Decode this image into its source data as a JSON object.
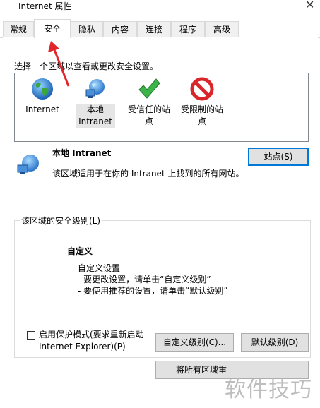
{
  "window": {
    "title": "Internet 属性"
  },
  "tabs": [
    {
      "label": "常规"
    },
    {
      "label": "安全"
    },
    {
      "label": "隐私"
    },
    {
      "label": "内容"
    },
    {
      "label": "连接"
    },
    {
      "label": "程序"
    },
    {
      "label": "高级"
    }
  ],
  "zones": {
    "instruction": "选择一个区域以查看或更改安全设置。",
    "items": [
      {
        "line1": "Internet",
        "line2": "",
        "icon": "globe-icon"
      },
      {
        "line1": "本地",
        "line2": "Intranet",
        "icon": "network-globe-icon"
      },
      {
        "line1": "受信任的站",
        "line2": "点",
        "icon": "green-check-icon"
      },
      {
        "line1": "受限制的站",
        "line2": "点",
        "icon": "no-entry-icon"
      }
    ]
  },
  "selected_zone": {
    "title": "本地 Intranet",
    "description": "该区域适用于在你的 Intranet 上找到的所有网站。",
    "sites_button": "站点(S)"
  },
  "security_level": {
    "legend": "该区域的安全级别(L)",
    "level_name": "自定义",
    "lines": [
      "自定义设置",
      "- 要更改设置，请单击“自定义级别”",
      "- 要使用推荐的设置，请单击“默认级别”"
    ]
  },
  "protected_mode": {
    "line1": "启用保护模式(要求重新启动",
    "line2": "Internet Explorer)(P)"
  },
  "buttons": {
    "custom_level": "自定义级别(C)...",
    "default_level": "默认级别(D)",
    "reset_all": "将所有区域重"
  },
  "watermark": "软件技巧",
  "colors": {
    "focus": "#0078d7",
    "annotation_arrow": "#e0262b"
  }
}
